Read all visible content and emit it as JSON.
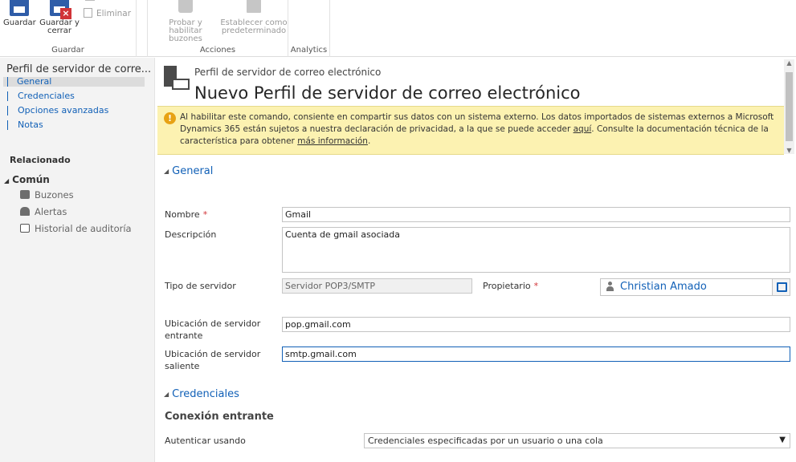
{
  "ribbon": {
    "save_label": "Guardar",
    "save_close_label_1": "Guardar y",
    "save_close_label_2": "cerrar",
    "delete_label": "Eliminar",
    "group_save": "Guardar",
    "test_enable_label_1": "Probar y habilitar",
    "test_enable_label_2": "buzones",
    "set_default_label_1": "Establecer como",
    "set_default_label_2": "predeterminado",
    "group_actions": "Acciones",
    "group_analytics": "Analytics"
  },
  "nav": {
    "title": "Perfil de servidor de corre...",
    "links": [
      "General",
      "Credenciales",
      "Opciones avanzadas",
      "Notas"
    ],
    "related": "Relacionado",
    "common": "Común",
    "common_items": [
      "Buzones",
      "Alertas",
      "Historial de auditoría"
    ]
  },
  "header": {
    "entity": "Perfil de servidor de correo electrónico",
    "title": "Nuevo Perfil de servidor de correo electrónico"
  },
  "warning": {
    "text1": "Al habilitar este comando, consiente en compartir sus datos con un sistema externo. Los datos importados de sistemas externos a Microsoft Dynamics 365 están sujetos a nuestra declaración de privacidad, a la que se puede acceder ",
    "link1": "aquí",
    "text2": ". Consulte la documentación técnica de la característica para obtener ",
    "link2": "más información",
    "text3": "."
  },
  "general": {
    "section": "General",
    "name_label": "Nombre",
    "name_value": "Gmail",
    "desc_label": "Descripción",
    "desc_value": "Cuenta de gmail asociada",
    "server_type_label": "Tipo de servidor",
    "server_type_value": "Servidor POP3/SMTP",
    "owner_label": "Propietario",
    "owner_value": "Christian Amado",
    "incoming_label_1": "Ubicación de servidor",
    "incoming_label_2": "entrante",
    "incoming_value": "pop.gmail.com",
    "outgoing_label_1": "Ubicación de servidor",
    "outgoing_label_2": "saliente",
    "outgoing_value": "smtp.gmail.com"
  },
  "credentials": {
    "section": "Credenciales",
    "incoming_heading": "Conexión entrante",
    "auth_label": "Autenticar usando",
    "auth_value": "Credenciales especificadas por un usuario o una cola"
  },
  "colors": {
    "link": "#1160b7",
    "warning_bg": "#fcf2b1",
    "required": "#d13438"
  }
}
